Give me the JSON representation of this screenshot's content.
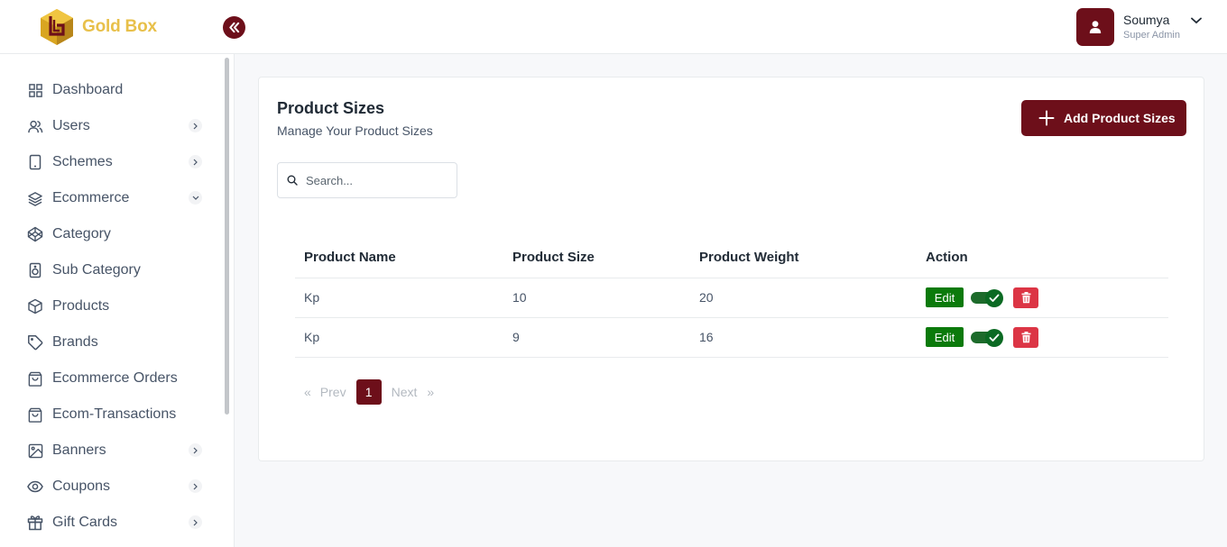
{
  "brand": {
    "name": "Gold Box"
  },
  "user": {
    "name": "Soumya",
    "role": "Super Admin"
  },
  "sidebar": {
    "items": [
      {
        "label": "Dashboard",
        "icon": "grid-icon",
        "chevron": ""
      },
      {
        "label": "Users",
        "icon": "users-icon",
        "chevron": "right"
      },
      {
        "label": "Schemes",
        "icon": "tablet-icon",
        "chevron": "right"
      },
      {
        "label": "Ecommerce",
        "icon": "layers-icon",
        "chevron": "down"
      },
      {
        "label": "Category",
        "icon": "codepen-icon",
        "chevron": ""
      },
      {
        "label": "Sub Category",
        "icon": "speaker-icon",
        "chevron": ""
      },
      {
        "label": "Products",
        "icon": "box-icon",
        "chevron": ""
      },
      {
        "label": "Brands",
        "icon": "tag-icon",
        "chevron": ""
      },
      {
        "label": "Ecommerce Orders",
        "icon": "shopping-bag-icon",
        "chevron": ""
      },
      {
        "label": "Ecom-Transactions",
        "icon": "shopping-bag-icon",
        "chevron": ""
      },
      {
        "label": "Banners",
        "icon": "image-icon",
        "chevron": "right"
      },
      {
        "label": "Coupons",
        "icon": "eye-icon",
        "chevron": "right"
      },
      {
        "label": "Gift Cards",
        "icon": "gift-icon",
        "chevron": "right"
      }
    ]
  },
  "page": {
    "title": "Product Sizes",
    "subtitle": "Manage Your Product Sizes",
    "add_button": "Add Product Sizes"
  },
  "search": {
    "placeholder": "Search..."
  },
  "table": {
    "headers": [
      "Product Name",
      "Product Size",
      "Product Weight",
      "Action"
    ],
    "rows": [
      {
        "name": "Kp",
        "size": "10",
        "weight": "20",
        "edit": "Edit",
        "active": true
      },
      {
        "name": "Kp",
        "size": "9",
        "weight": "16",
        "edit": "Edit",
        "active": true
      }
    ]
  },
  "pagination": {
    "first": "«",
    "prev": "Prev",
    "current": "1",
    "next": "Next",
    "last": "»"
  },
  "colors": {
    "primary": "#6d0f1a",
    "gold": "#e8c04a",
    "success": "#0b7a0b",
    "danger": "#dc3545"
  }
}
